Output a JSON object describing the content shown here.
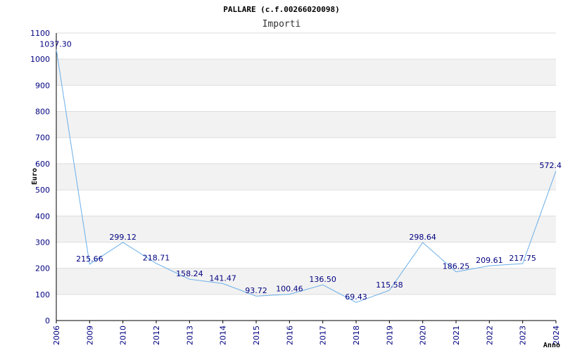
{
  "chart_data": {
    "type": "line",
    "title": "PALLARE (c.f.00266020098)",
    "subtitle": "Importi",
    "xlabel": "Anno",
    "ylabel": "Euro",
    "ylim": [
      0,
      1100
    ],
    "yticks": [
      0,
      100,
      200,
      300,
      400,
      500,
      600,
      700,
      800,
      900,
      1000,
      1100
    ],
    "grid": "horizontal alternating bands",
    "categories": [
      "2006",
      "2009",
      "2010",
      "2012",
      "2013",
      "2014",
      "2015",
      "2016",
      "2017",
      "2018",
      "2019",
      "2020",
      "2021",
      "2022",
      "2023",
      "2024"
    ],
    "values": [
      1037.3,
      215.66,
      299.12,
      218.71,
      158.24,
      141.47,
      93.72,
      100.46,
      136.5,
      69.43,
      115.58,
      298.64,
      186.25,
      209.61,
      217.75,
      572.4
    ],
    "data_labels": [
      "1037.30",
      "215.66",
      "299.12",
      "218.71",
      "158.24",
      "141.47",
      "93.72",
      "100.46",
      "136.50",
      "69.43",
      "115.58",
      "298.64",
      "186.25",
      "209.61",
      "217.75",
      "572.4"
    ],
    "colors": {
      "line": "#6aaee8",
      "band": "#f2f2f2",
      "gridline": "#dddddd",
      "tick_text": "#000080",
      "axis": "#000000"
    }
  }
}
